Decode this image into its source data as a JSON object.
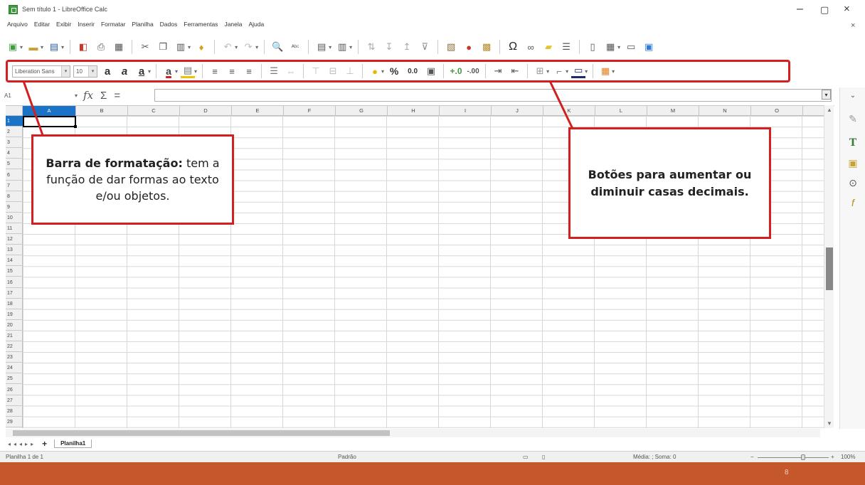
{
  "window": {
    "title": "Sem título 1 - LibreOffice Calc",
    "minimize": "–",
    "maximize": "▢",
    "close": "×",
    "doc_close": "×"
  },
  "menu": {
    "items": [
      "Arquivo",
      "Editar",
      "Exibir",
      "Inserir",
      "Formatar",
      "Planilha",
      "Dados",
      "Ferramentas",
      "Janela",
      "Ajuda"
    ]
  },
  "formatting": {
    "font_name": "Liberation Sans",
    "font_size": "10",
    "percent": "%",
    "decimal_label": "0.0"
  },
  "formula_bar": {
    "cell_ref": "A1",
    "fx_symbol": "fx",
    "sum_symbol": "Σ",
    "equals_symbol": "="
  },
  "grid": {
    "columns": [
      "A",
      "B",
      "C",
      "D",
      "E",
      "F",
      "G",
      "H",
      "I",
      "J",
      "K",
      "L",
      "M",
      "N",
      "O"
    ],
    "rows": [
      "1",
      "2",
      "3",
      "4",
      "5",
      "6",
      "7",
      "8",
      "9",
      "10",
      "11",
      "12",
      "13",
      "14",
      "15",
      "16",
      "17",
      "18",
      "19",
      "20",
      "21",
      "22",
      "23",
      "24",
      "25",
      "26",
      "27",
      "28",
      "29"
    ],
    "active_cell": "A1"
  },
  "sheets": {
    "tabs": [
      "Planilha1"
    ],
    "add_symbol": "+"
  },
  "status": {
    "sheet_position": "Planilha 1 de 1",
    "page_style": "Padrão",
    "summary": "Média: ; Soma: 0",
    "zoom": "100%"
  },
  "taskbar": {
    "number": "8"
  },
  "callouts": {
    "left_bold": "Barra de formatação:",
    "left_text": " tem a função de dar formas ao texto e/ou objetos.",
    "right_text": "Botões para aumentar ou diminuir casas decimais."
  },
  "colors": {
    "highlight_red": "#d21f1f",
    "active_header_blue": "#1a73c7",
    "taskbar_orange": "#c5582a"
  }
}
